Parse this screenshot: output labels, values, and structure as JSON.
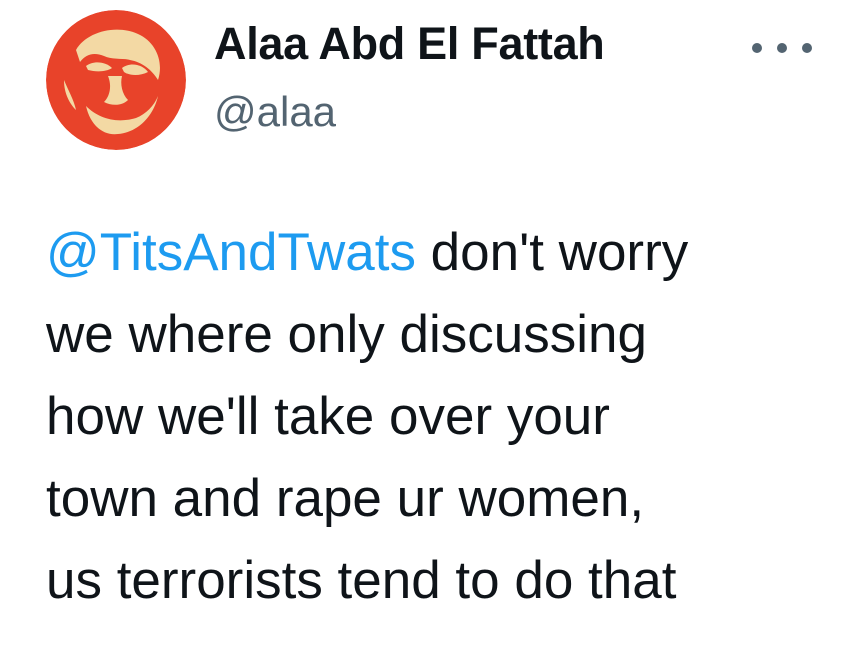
{
  "author": {
    "display_name": "Alaa Abd El Fattah",
    "handle": "@alaa"
  },
  "avatar": {
    "background_color": "#e8432a",
    "figure_color": "#f3d9a4"
  },
  "more_icon": "more-horizontal-icon",
  "tweet": {
    "mention": "@TitsAndTwats",
    "line1_rest": " don't worry",
    "line2": "we where only discussing",
    "line3": "how we'll take over your",
    "line4": "town and rape ur women,",
    "line5": "us terrorists tend to do that"
  },
  "colors": {
    "mention": "#1d9bf0",
    "text": "#0f1419",
    "secondary_text": "#536471"
  }
}
